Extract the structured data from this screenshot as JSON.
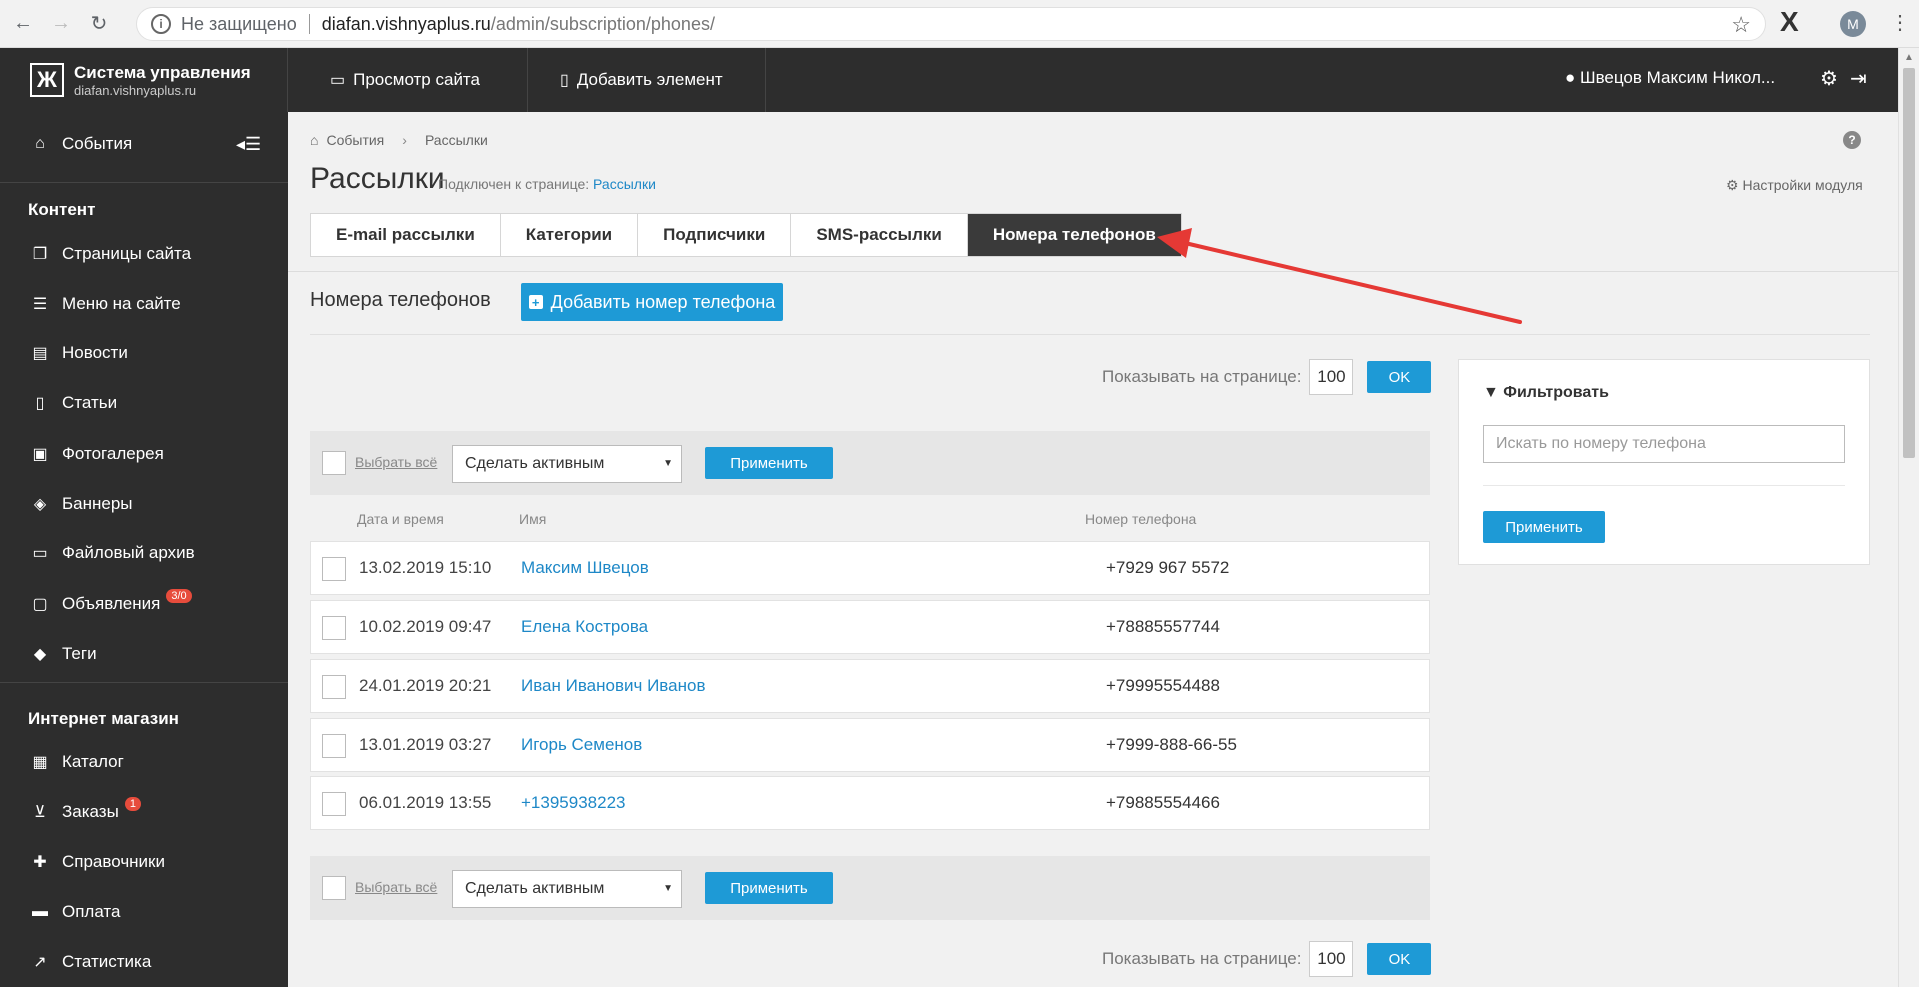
{
  "browser": {
    "security": "Не защищено",
    "url_host": "diafan.vishnyaplus.ru",
    "url_path": "/admin/subscription/phones/",
    "avatar_letter": "M"
  },
  "header": {
    "brand_title": "Система управления",
    "brand_subtitle": "diafan.vishnyaplus.ru",
    "view_site": "Просмотр сайта",
    "add_element": "Добавить элемент",
    "user_name": "Швецов Максим Никол..."
  },
  "sidebar": {
    "events": "События",
    "content_heading": "Контент",
    "content_items": [
      {
        "label": "Страницы сайта",
        "icon": "pages-icon"
      },
      {
        "label": "Меню на сайте",
        "icon": "menu-icon"
      },
      {
        "label": "Новости",
        "icon": "news-icon"
      },
      {
        "label": "Статьи",
        "icon": "articles-icon"
      },
      {
        "label": "Фотогалерея",
        "icon": "gallery-icon"
      },
      {
        "label": "Баннеры",
        "icon": "banner-icon"
      },
      {
        "label": "Файловый архив",
        "icon": "folder-icon"
      },
      {
        "label": "Объявления",
        "icon": "ads-icon",
        "badge": "3/0"
      },
      {
        "label": "Теги",
        "icon": "tags-icon"
      }
    ],
    "shop_heading": "Интернет магазин",
    "shop_items": [
      {
        "label": "Каталог",
        "icon": "catalog-icon"
      },
      {
        "label": "Заказы",
        "icon": "cart-icon",
        "badge": "1"
      },
      {
        "label": "Справочники",
        "icon": "puzzle-icon"
      },
      {
        "label": "Оплата",
        "icon": "card-icon"
      },
      {
        "label": "Статистика",
        "icon": "chart-icon"
      }
    ]
  },
  "main": {
    "breadcrumb": [
      "События",
      "Рассылки"
    ],
    "title": "Рассылки",
    "subtitle_prefix": "Подключен к странице:",
    "subtitle_link": "Рассылки",
    "module_settings": "Настройки модуля",
    "tabs": [
      "E-mail рассылки",
      "Категории",
      "Подписчики",
      "SMS-рассылки",
      "Номера телефонов"
    ],
    "active_tab": "Номера телефонов",
    "section_title": "Номера телефонов",
    "add_button": "Добавить номер телефона",
    "per_page_label": "Показывать на странице:",
    "per_page_value": "100",
    "ok_label": "OK",
    "select_all": "Выбрать всё",
    "action_select": "Сделать активным",
    "apply_label": "Применить",
    "columns": [
      "Дата и время",
      "Имя",
      "Номер телефона"
    ],
    "rows": [
      {
        "date": "13.02.2019 15:10",
        "name": "Максим Швецов",
        "phone": "+7929 967 5572"
      },
      {
        "date": "10.02.2019 09:47",
        "name": "Елена Кострова",
        "phone": "+78885557744"
      },
      {
        "date": "24.01.2019 20:21",
        "name": "Иван Иванович Иванов",
        "phone": "+79995554488"
      },
      {
        "date": "13.01.2019 03:27",
        "name": "Игорь Семенов",
        "phone": "+7999-888-66-55"
      },
      {
        "date": "06.01.2019 13:55",
        "name": "+1395938223",
        "phone": "+79885554466"
      }
    ]
  },
  "filter": {
    "title": "Фильтровать",
    "placeholder": "Искать по номеру телефона",
    "apply": "Применить"
  },
  "colors": {
    "accent": "#1e9ad6",
    "dark": "#2d2d2d",
    "link": "#1e88c7",
    "annotation_arrow": "#e53935"
  }
}
